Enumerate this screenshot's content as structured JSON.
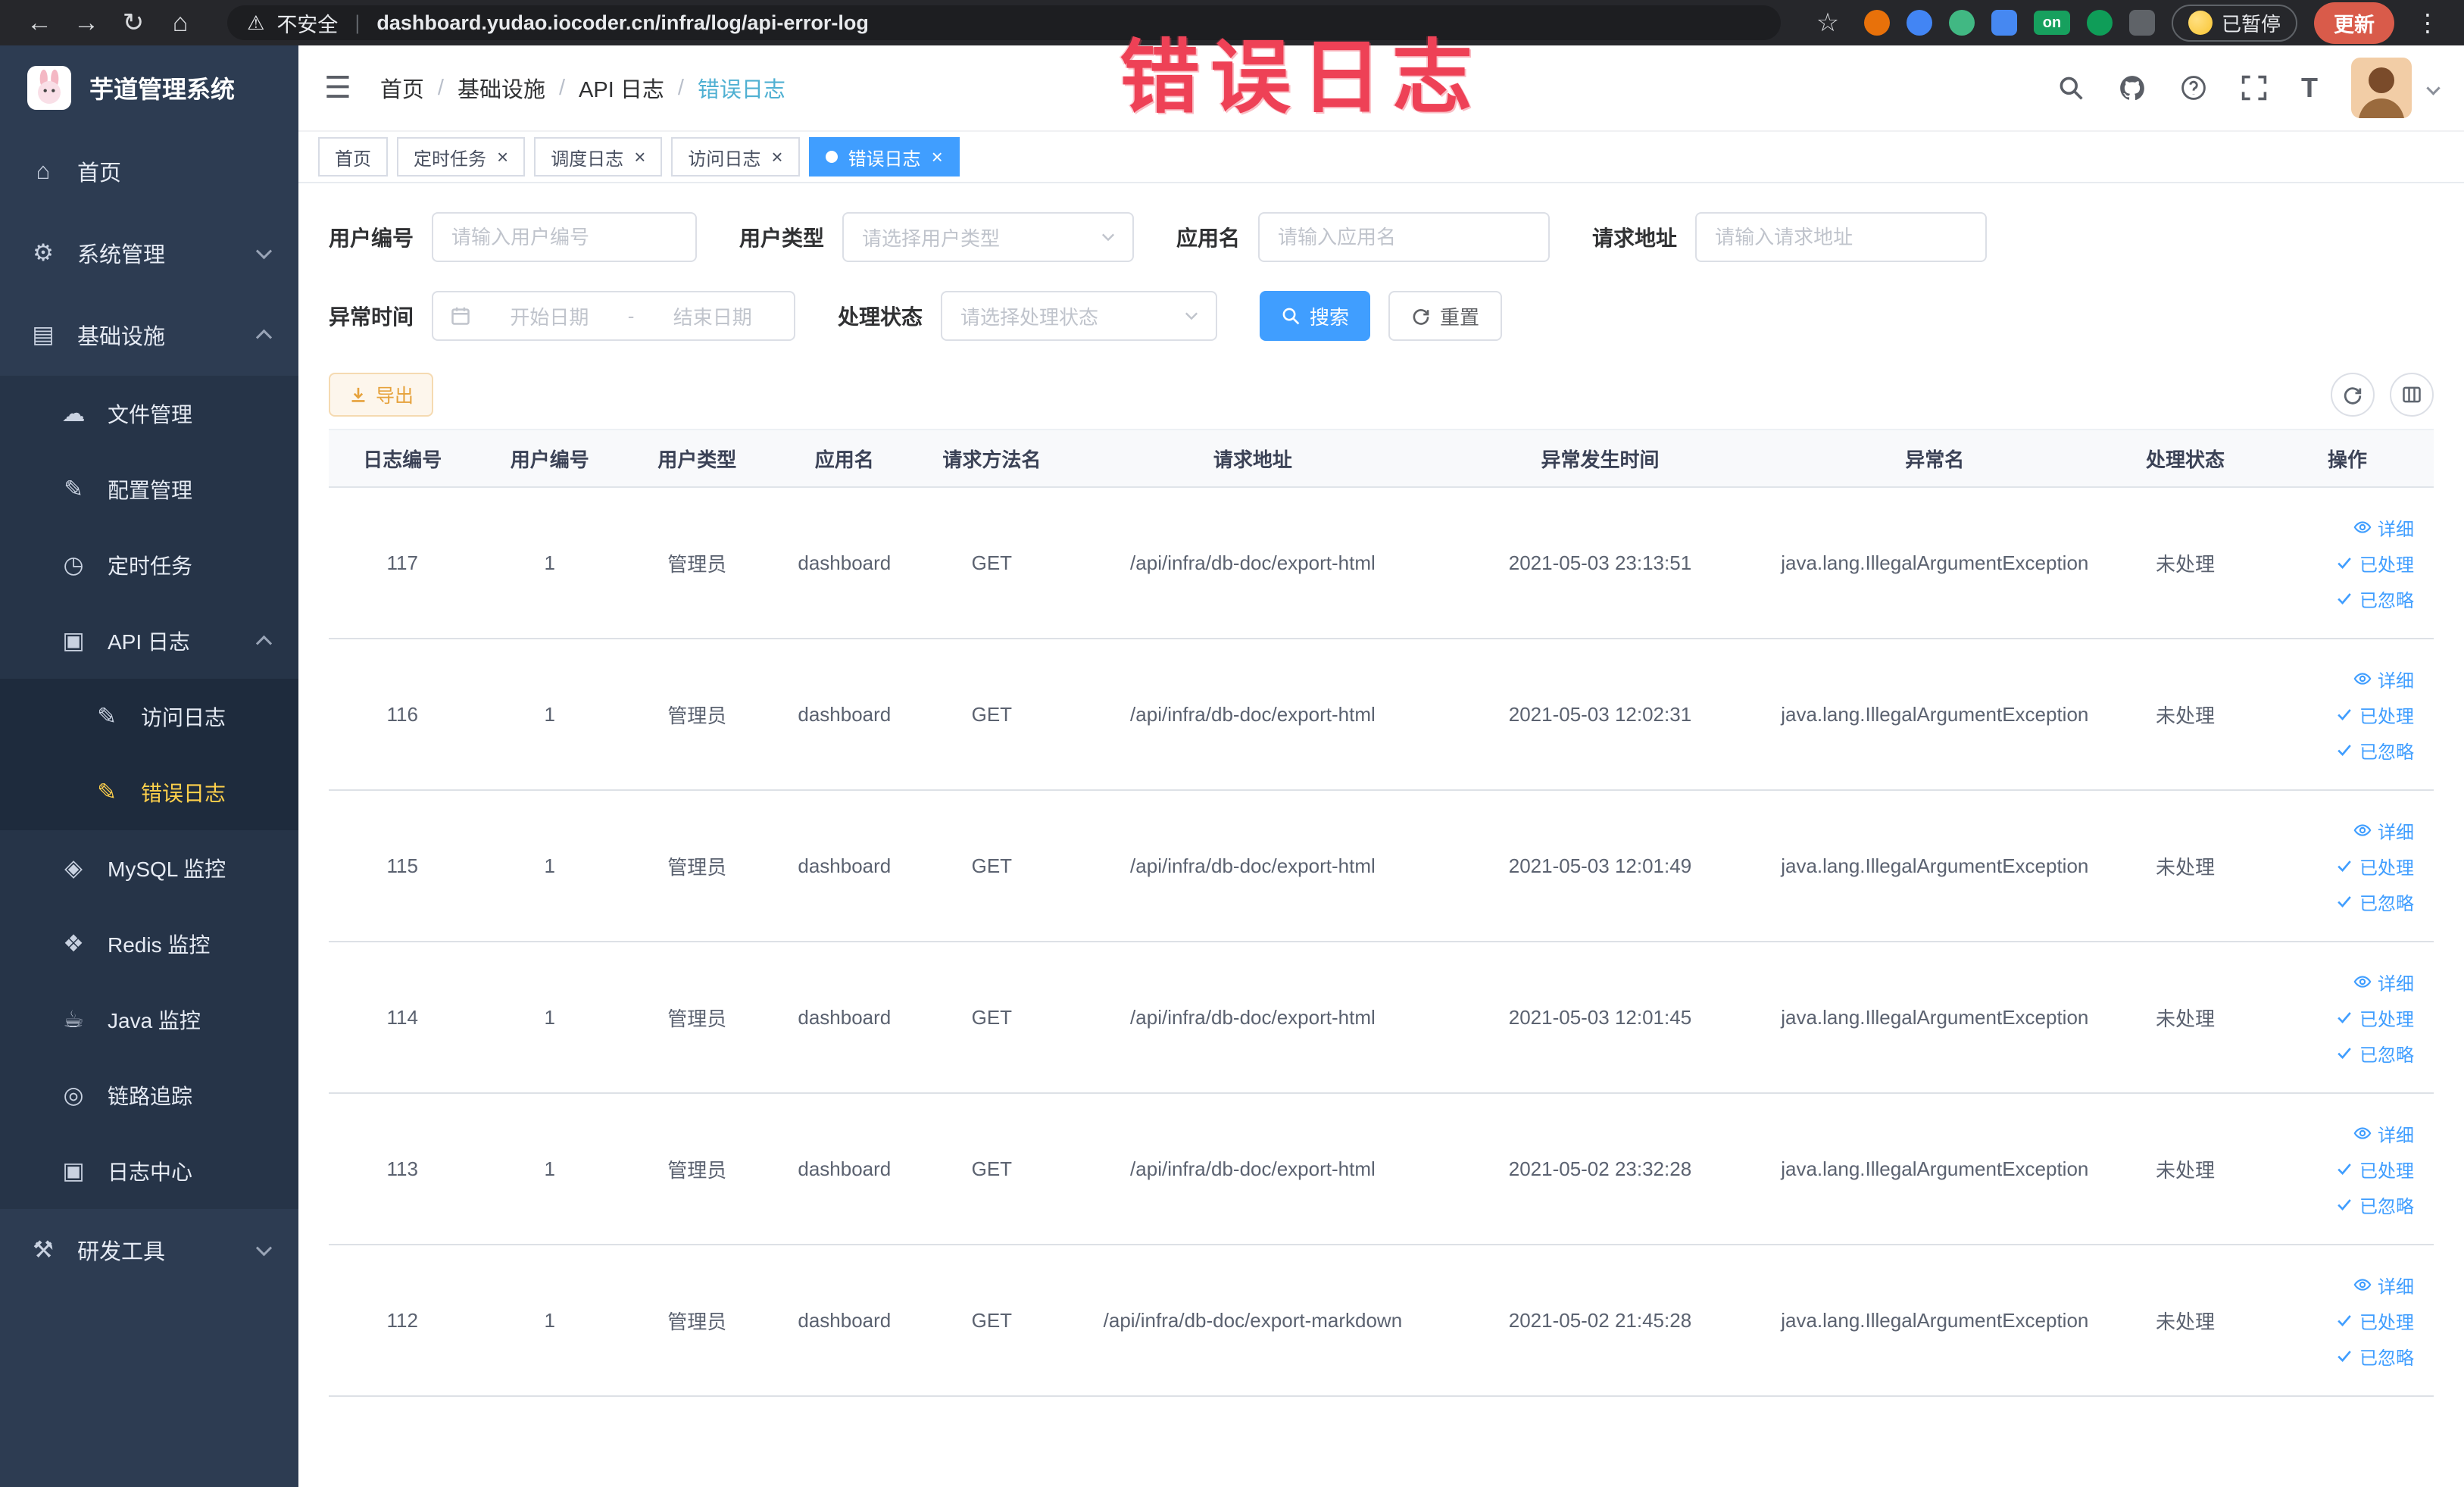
{
  "browser": {
    "security_label": "不安全",
    "url": "dashboard.yudao.iocoder.cn/infra/log/api-error-log",
    "on_badge": "on",
    "paused_badge": "已暂停",
    "update_button": "更新"
  },
  "icons": {
    "back": "←",
    "forward": "→",
    "reload": "↻",
    "home_nav": "⌂",
    "warning": "⚠",
    "star": "☆",
    "kebab": "⋮",
    "hamburger": "☰",
    "home": "⌂",
    "system": "⚙",
    "infra": "▤",
    "file": "☁",
    "config": "✎",
    "timer": "◷",
    "api_log": "▣",
    "doc_edit": "✎",
    "mysql": "◈",
    "redis": "❖",
    "java": "☕",
    "trace": "◎",
    "log_center": "▣",
    "devtools": "⚒",
    "font_size": "T",
    "close": "×"
  },
  "sidebar": {
    "logo_text": "芋道管理系统",
    "home": "首页",
    "system_mgmt": "系统管理",
    "infrastructure": "基础设施",
    "file_mgmt": "文件管理",
    "config_mgmt": "配置管理",
    "scheduled_tasks": "定时任务",
    "api_log": "API 日志",
    "access_log": "访问日志",
    "error_log": "错误日志",
    "mysql_monitor": "MySQL 监控",
    "redis_monitor": "Redis 监控",
    "java_monitor": "Java 监控",
    "tracing": "链路追踪",
    "log_center": "日志中心",
    "dev_tools": "研发工具"
  },
  "header": {
    "breadcrumb": [
      "首页",
      "基础设施",
      "API 日志",
      "错误日志"
    ],
    "separator": "/"
  },
  "annotation": "错误日志",
  "tabs": [
    {
      "label": "首页",
      "closable": false,
      "active": false
    },
    {
      "label": "定时任务",
      "closable": true,
      "active": false
    },
    {
      "label": "调度日志",
      "closable": true,
      "active": false
    },
    {
      "label": "访问日志",
      "closable": true,
      "active": false
    },
    {
      "label": "错误日志",
      "closable": true,
      "active": true
    }
  ],
  "filters": {
    "user_id_label": "用户编号",
    "user_id_placeholder": "请输入用户编号",
    "user_type_label": "用户类型",
    "user_type_placeholder": "请选择用户类型",
    "app_name_label": "应用名",
    "app_name_placeholder": "请输入应用名",
    "request_url_label": "请求地址",
    "request_url_placeholder": "请输入请求地址",
    "exception_time_label": "异常时间",
    "start_date_placeholder": "开始日期",
    "range_separator": "-",
    "end_date_placeholder": "结束日期",
    "process_status_label": "处理状态",
    "process_status_placeholder": "请选择处理状态",
    "search_button": "搜索",
    "reset_button": "重置"
  },
  "toolbar": {
    "export_button": "导出"
  },
  "table": {
    "headers": [
      "日志编号",
      "用户编号",
      "用户类型",
      "应用名",
      "请求方法名",
      "请求地址",
      "异常发生时间",
      "异常名",
      "处理状态",
      "操作"
    ],
    "actions": {
      "detail": "详细",
      "processed": "已处理",
      "ignored": "已忽略"
    },
    "rows": [
      {
        "id": "117",
        "user_id": "1",
        "user_type": "管理员",
        "app": "dashboard",
        "method": "GET",
        "url": "/api/infra/db-doc/export-html",
        "time": "2021-05-03 23:13:51",
        "exception": "java.lang.IllegalArgumentException",
        "status": "未处理"
      },
      {
        "id": "116",
        "user_id": "1",
        "user_type": "管理员",
        "app": "dashboard",
        "method": "GET",
        "url": "/api/infra/db-doc/export-html",
        "time": "2021-05-03 12:02:31",
        "exception": "java.lang.IllegalArgumentException",
        "status": "未处理"
      },
      {
        "id": "115",
        "user_id": "1",
        "user_type": "管理员",
        "app": "dashboard",
        "method": "GET",
        "url": "/api/infra/db-doc/export-html",
        "time": "2021-05-03 12:01:49",
        "exception": "java.lang.IllegalArgumentException",
        "status": "未处理"
      },
      {
        "id": "114",
        "user_id": "1",
        "user_type": "管理员",
        "app": "dashboard",
        "method": "GET",
        "url": "/api/infra/db-doc/export-html",
        "time": "2021-05-03 12:01:45",
        "exception": "java.lang.IllegalArgumentException",
        "status": "未处理"
      },
      {
        "id": "113",
        "user_id": "1",
        "user_type": "管理员",
        "app": "dashboard",
        "method": "GET",
        "url": "/api/infra/db-doc/export-html",
        "time": "2021-05-02 23:32:28",
        "exception": "java.lang.IllegalArgumentException",
        "status": "未处理"
      },
      {
        "id": "112",
        "user_id": "1",
        "user_type": "管理员",
        "app": "dashboard",
        "method": "GET",
        "url": "/api/infra/db-doc/export-markdown",
        "time": "2021-05-02 21:45:28",
        "exception": "java.lang.IllegalArgumentException",
        "status": "未处理"
      }
    ]
  },
  "colors": {
    "accent": "#409eff",
    "active_menu_item": "#ffd04b",
    "warning": "#e6a23c",
    "annotation": "#ee4156",
    "sidebar_bg": "#2d3c52",
    "browser_bar_bg": "#26272b"
  }
}
